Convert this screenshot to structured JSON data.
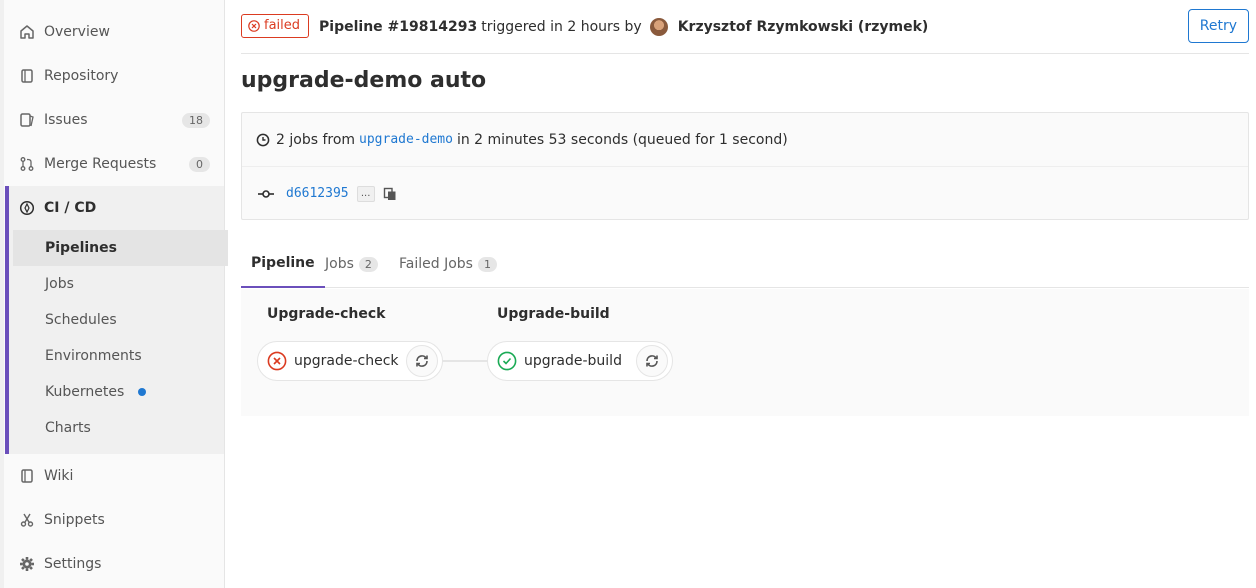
{
  "sidebar": {
    "items": [
      {
        "label": "Overview",
        "icon": "home-icon"
      },
      {
        "label": "Repository",
        "icon": "book-icon"
      },
      {
        "label": "Issues",
        "icon": "issues-icon",
        "count": "18"
      },
      {
        "label": "Merge Requests",
        "icon": "merge-request-icon",
        "count": "0"
      }
    ],
    "cicd": {
      "label": "CI / CD",
      "icon": "rocket-icon",
      "subitems": [
        "Pipelines",
        "Jobs",
        "Schedules",
        "Environments",
        "Kubernetes",
        "Charts"
      ]
    },
    "bottom_items": [
      {
        "label": "Wiki",
        "icon": "book-icon"
      },
      {
        "label": "Snippets",
        "icon": "scissors-icon"
      },
      {
        "label": "Settings",
        "icon": "gear-icon"
      }
    ]
  },
  "header": {
    "status": "failed",
    "pipeline_label": "Pipeline #19814293",
    "triggered_text": "triggered in 2 hours by",
    "user": "Krzysztof Rzymkowski (rzymek)",
    "retry_label": "Retry"
  },
  "page_title": "upgrade-demo auto",
  "info": {
    "jobs_prefix": "2 jobs from",
    "branch": "upgrade-demo",
    "duration_text": "in 2 minutes 53 seconds (queued for 1 second)",
    "commit_sha": "d6612395",
    "ellipsis": "..."
  },
  "tabs": [
    {
      "label": "Pipeline",
      "count": null
    },
    {
      "label": "Jobs",
      "count": "2"
    },
    {
      "label": "Failed Jobs",
      "count": "1"
    }
  ],
  "stages": [
    {
      "title": "Upgrade-check",
      "job": "upgrade-check",
      "status": "failed"
    },
    {
      "title": "Upgrade-build",
      "job": "upgrade-build",
      "status": "success"
    }
  ],
  "colors": {
    "accent": "#6b4fbb",
    "link": "#1f78d1",
    "failed": "#db3b21",
    "success": "#1aaa55"
  }
}
